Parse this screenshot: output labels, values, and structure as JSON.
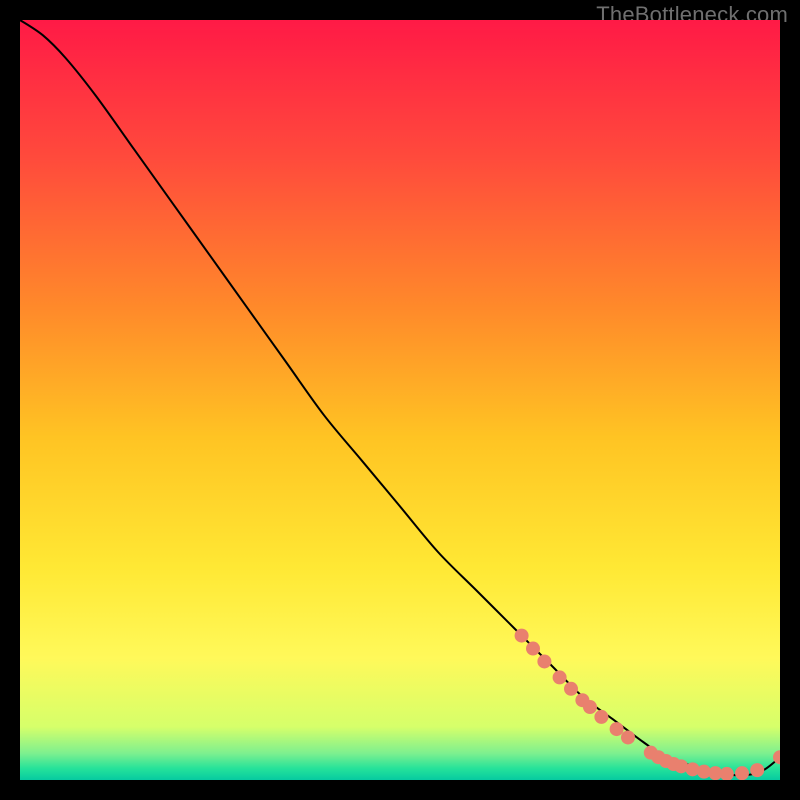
{
  "watermark": "TheBottleneck.com",
  "chart_data": {
    "type": "line",
    "title": "",
    "xlabel": "",
    "ylabel": "",
    "xlim": [
      0,
      100
    ],
    "ylim": [
      0,
      100
    ],
    "background_gradient": {
      "stops": [
        {
          "offset": 0.0,
          "color": "#ff1a46"
        },
        {
          "offset": 0.18,
          "color": "#ff4a3c"
        },
        {
          "offset": 0.38,
          "color": "#ff8a2a"
        },
        {
          "offset": 0.55,
          "color": "#ffc423"
        },
        {
          "offset": 0.72,
          "color": "#ffe834"
        },
        {
          "offset": 0.84,
          "color": "#fff95a"
        },
        {
          "offset": 0.93,
          "color": "#d6ff6a"
        },
        {
          "offset": 0.965,
          "color": "#7df08f"
        },
        {
          "offset": 0.985,
          "color": "#25e29a"
        },
        {
          "offset": 1.0,
          "color": "#06caa0"
        }
      ]
    },
    "series": [
      {
        "name": "bottleneck-curve",
        "color": "#000000",
        "x": [
          0,
          3,
          6,
          10,
          15,
          20,
          25,
          30,
          35,
          40,
          45,
          50,
          55,
          60,
          65,
          70,
          74,
          78,
          82,
          85,
          88,
          90,
          93,
          96,
          98,
          100
        ],
        "y": [
          100,
          98,
          95,
          90,
          83,
          76,
          69,
          62,
          55,
          48,
          42,
          36,
          30,
          25,
          20,
          15,
          11,
          8,
          5,
          3,
          2,
          1.2,
          0.7,
          0.7,
          1.4,
          3
        ]
      }
    ],
    "markers": {
      "name": "highlight-points",
      "color": "#e9806e",
      "radius_px": 7,
      "points": [
        {
          "x": 66,
          "y": 19.0
        },
        {
          "x": 67.5,
          "y": 17.3
        },
        {
          "x": 69,
          "y": 15.6
        },
        {
          "x": 71,
          "y": 13.5
        },
        {
          "x": 72.5,
          "y": 12.0
        },
        {
          "x": 74,
          "y": 10.5
        },
        {
          "x": 75,
          "y": 9.6
        },
        {
          "x": 76.5,
          "y": 8.3
        },
        {
          "x": 78.5,
          "y": 6.7
        },
        {
          "x": 80,
          "y": 5.6
        },
        {
          "x": 83,
          "y": 3.6
        },
        {
          "x": 84,
          "y": 3.0
        },
        {
          "x": 85,
          "y": 2.5
        },
        {
          "x": 86,
          "y": 2.1
        },
        {
          "x": 87,
          "y": 1.8
        },
        {
          "x": 88.5,
          "y": 1.4
        },
        {
          "x": 90,
          "y": 1.1
        },
        {
          "x": 91.5,
          "y": 0.9
        },
        {
          "x": 93,
          "y": 0.8
        },
        {
          "x": 95,
          "y": 0.9
        },
        {
          "x": 97,
          "y": 1.3
        },
        {
          "x": 100,
          "y": 3.0
        }
      ]
    }
  }
}
